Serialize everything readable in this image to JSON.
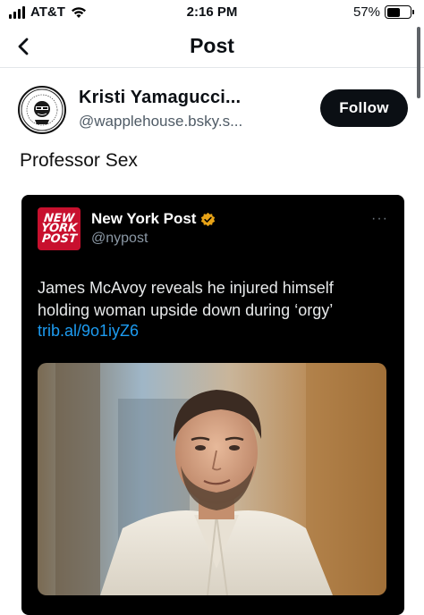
{
  "status_bar": {
    "carrier": "AT&T",
    "time": "2:16 PM",
    "battery_percent": "57%",
    "battery_level": 0.57
  },
  "nav": {
    "title": "Post",
    "back_icon": "chevron-left-icon"
  },
  "post": {
    "author_name": "Kristi Yamagucci...",
    "author_handle": "@wapplehouse.bsky.s...",
    "follow_label": "Follow",
    "text": "Professor Sex",
    "embed": {
      "source_name": "New York Post",
      "source_handle": "@nypost",
      "logo_lines": [
        "NEW",
        "YORK",
        "POST"
      ],
      "more_label": "···",
      "headline": "James McAvoy reveals he injured himself holding woman upside down during ‘orgy’",
      "link": "trib.al/9o1iyZ6",
      "verified_icon": "verified-badge-icon"
    }
  },
  "colors": {
    "follow_bg": "#0b0f14",
    "link": "#1d9bf0",
    "nyp_red": "#c8102e",
    "verified_gold": "#e8a317"
  }
}
